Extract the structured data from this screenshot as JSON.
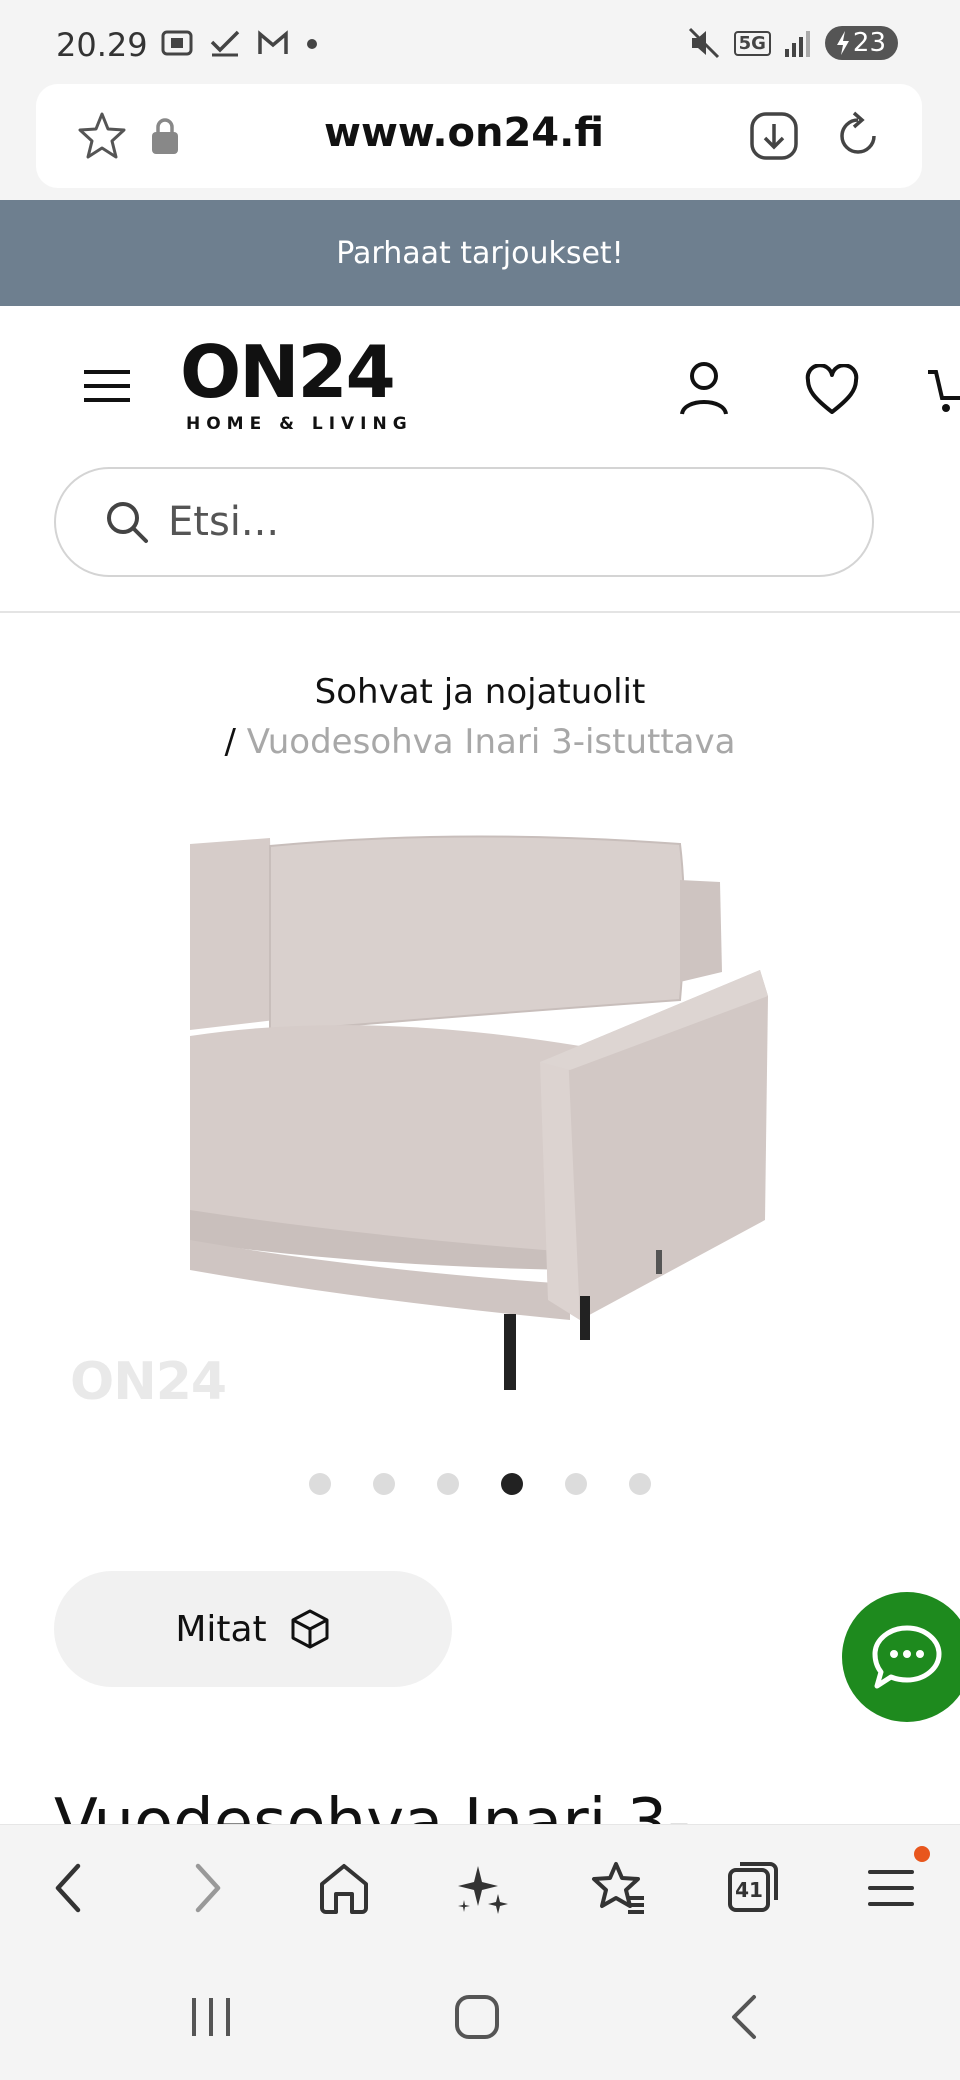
{
  "status_bar": {
    "time": "20.29",
    "network": "5G",
    "battery": "23",
    "icons": [
      "screenshot-icon",
      "check-icon",
      "gmail-icon",
      "dot-icon",
      "mute-icon",
      "signal-icon",
      "battery-charging-icon"
    ]
  },
  "browser": {
    "url": "www.on24.fi",
    "icons": [
      "star-icon",
      "lock-icon",
      "download-icon",
      "reload-icon"
    ]
  },
  "promo": {
    "text": "Parhaat tarjoukset!"
  },
  "header": {
    "logo_main": "ON24",
    "logo_sub": "HOME & LIVING",
    "icons": [
      "menu-icon",
      "account-icon",
      "heart-icon",
      "cart-icon"
    ]
  },
  "search": {
    "placeholder": "Etsi..."
  },
  "breadcrumb": {
    "category": "Sohvat ja nojatuolit",
    "separator": "/",
    "current": "Vuodesohva Inari 3-istuttava"
  },
  "gallery": {
    "watermark": "ON24",
    "slide_count": 6,
    "active_slide": 4
  },
  "mitat_button": {
    "label": "Mitat"
  },
  "product": {
    "title": "Vuodesohva Inari 3-"
  },
  "bottom_toolbar": {
    "tabs_count": "41",
    "icons": [
      "back-icon",
      "forward-icon",
      "home-icon",
      "ai-sparkle-icon",
      "bookmarks-icon",
      "tabs-icon",
      "menu-icon"
    ]
  },
  "colors": {
    "promo_bg": "#6e7f8f",
    "chat_bg": "#1e8a1e",
    "notification_dot": "#e8561d",
    "sofa": "#d8cfcc"
  }
}
